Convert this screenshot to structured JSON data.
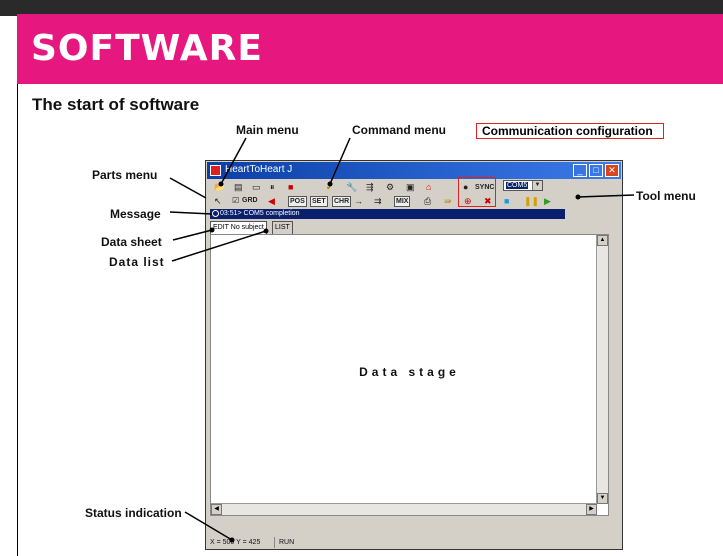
{
  "banner": {
    "title": "SOFTWARE",
    "color": "#e6177e"
  },
  "subtitle": "The start of software",
  "annotations": {
    "main_menu": "Main menu",
    "command_menu": "Command menu",
    "communication_configuration": "Communication configuration",
    "parts_menu": "Parts menu",
    "tool_menu": "Tool menu",
    "message": "Message",
    "data_sheet": "Data sheet",
    "data_list": "Data list",
    "status_indication": "Status indication"
  },
  "window": {
    "title": "HeartToHeart J",
    "toolbar1": {
      "sync_label": "SYNC",
      "port_select": "COM5"
    },
    "toolbar2": {
      "grid_label": "GRD",
      "pos_label": "POS",
      "set_label": "SET",
      "chr_label": "CHR",
      "mix_label": "MIX"
    },
    "message": "03:51> COM5 completion",
    "tabs": [
      "EDIT No subject",
      "LIST"
    ],
    "stage_text": "Data stage",
    "status": {
      "coords": "X = 500  Y = 425",
      "mode": "RUN"
    }
  }
}
